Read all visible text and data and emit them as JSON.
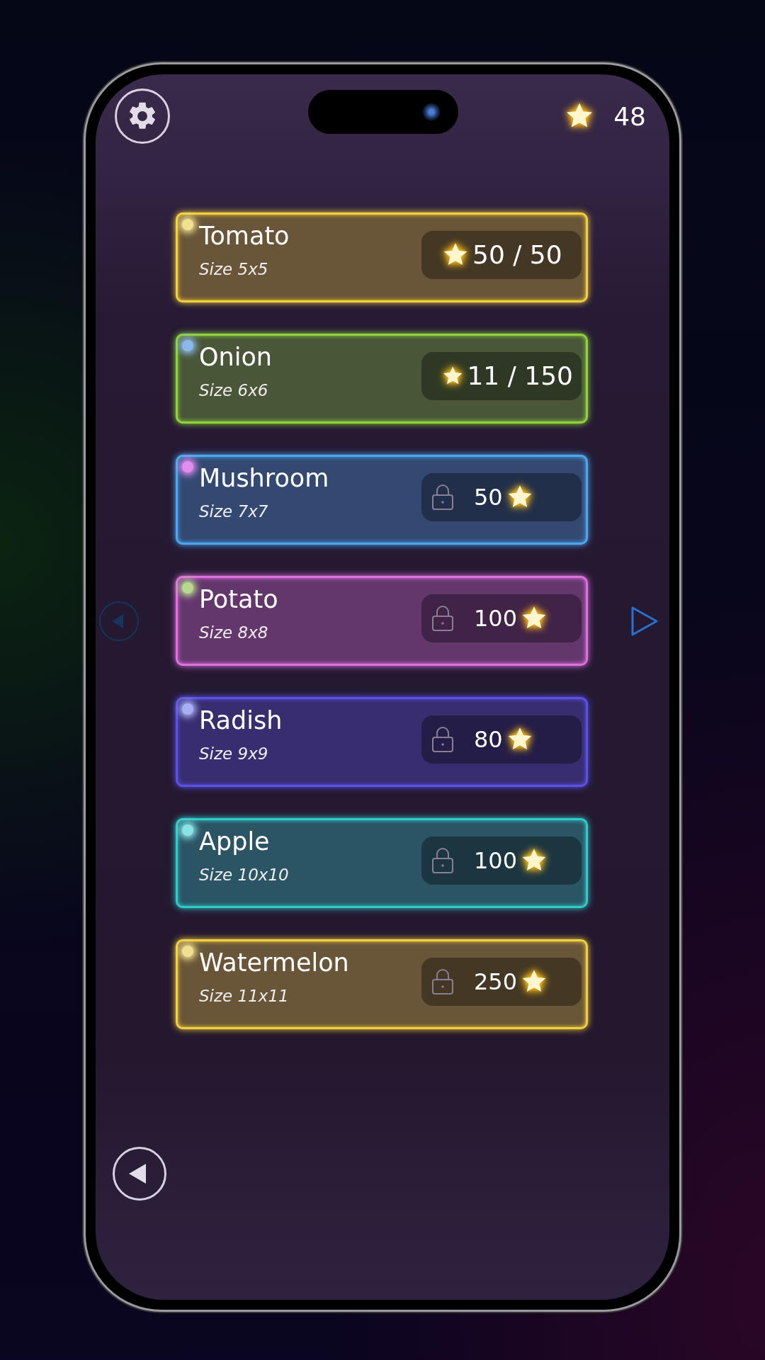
{
  "header": {
    "star_count": "48"
  },
  "levels": [
    {
      "name": "Tomato",
      "size": "Size 5x5",
      "color": "#f2cf3c",
      "dot": {
        "color": "#f0e090"
      },
      "locked": false,
      "stars_text": "50 / 50"
    },
    {
      "name": "Onion",
      "size": "Size 6x6",
      "color": "#8fd23c",
      "dot": {
        "color": "#8ab8e8"
      },
      "locked": false,
      "stars_text": "11 / 150"
    },
    {
      "name": "Mushroom",
      "size": "Size 7x7",
      "color": "#4ba8f0",
      "dot": {
        "color": "#e08cf0"
      },
      "locked": true,
      "stars_text": "50"
    },
    {
      "name": "Potato",
      "size": "Size 8x8",
      "color": "#e070e0",
      "dot": {
        "color": "#b8d890"
      },
      "locked": true,
      "stars_text": "100"
    },
    {
      "name": "Radish",
      "size": "Size 9x9",
      "color": "#5a52e6",
      "dot": {
        "color": "#a8b0f4"
      },
      "locked": true,
      "stars_text": "80"
    },
    {
      "name": "Apple",
      "size": "Size 10x10",
      "color": "#30cac8",
      "dot": {
        "color": "#88e4e4"
      },
      "locked": true,
      "stars_text": "100"
    },
    {
      "name": "Watermelon",
      "size": "Size 11x11",
      "color": "#f2cf3c",
      "dot": {
        "color": "#f0e090"
      },
      "locked": true,
      "stars_text": "250"
    }
  ],
  "nav": {
    "prev_disabled": true,
    "next_disabled": false
  }
}
